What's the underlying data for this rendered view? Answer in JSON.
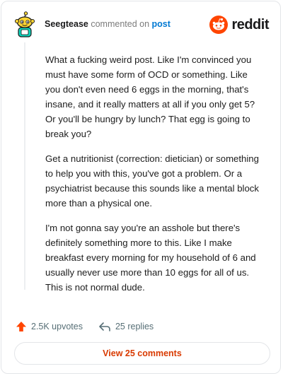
{
  "header": {
    "username": "Seegtease",
    "verb": "commented on",
    "link_text": "post",
    "brand": "reddit"
  },
  "comment": {
    "paragraphs": [
      "What a fucking weird post. Like I'm convinced you must have some form of OCD or something. Like you don't even need 6 eggs in the morning, that's insane, and it really matters at all if you only get 5? Or you'll be hungry by lunch? That egg is going to break you?",
      "Get a nutritionist (correction: dietician) or something to help you with this, you've got a problem. Or a psychiatrist because this sounds like a mental block more than a physical one.",
      "I'm not gonna say you're an asshole but there's definitely something more to this. Like I make breakfast every morning for my household of 6 and usually never use more than 10 eggs for all of us. This is not normal dude."
    ]
  },
  "actions": {
    "upvotes": "2.5K upvotes",
    "replies": "25 replies"
  },
  "view_button": {
    "label": "View 25 comments"
  },
  "colors": {
    "brand_orange": "#ff4500",
    "link_blue": "#0079d3",
    "button_text": "#d93a00"
  },
  "icons": {
    "avatar": "snoo-avatar",
    "brand": "reddit-logo-icon",
    "upvote": "upvote-arrow-icon",
    "reply": "reply-arrow-icon"
  }
}
